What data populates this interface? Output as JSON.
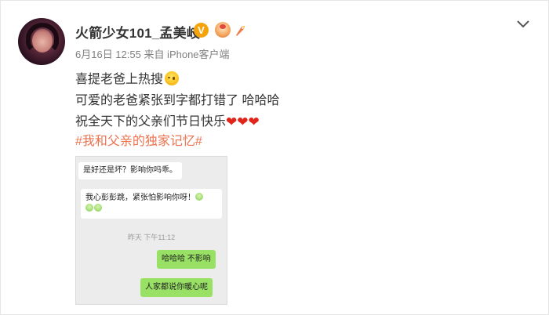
{
  "post": {
    "username": "火箭少女101_孟美岐",
    "verified_badge": "V",
    "meta": "6月16日 12:55 来自 iPhone客户端",
    "lines": [
      "喜提老爸上热搜",
      "可爱的老爸紧张到字都打错了 哈哈哈",
      "祝全天下的父亲们节日快乐"
    ],
    "hashtag": "#我和父亲的独家记忆#",
    "icons": {
      "line1_emoji": "embarrassed-face-icon",
      "hearts": [
        "heart-icon",
        "heart-icon",
        "heart-icon"
      ]
    }
  },
  "chat": {
    "msg1": "是好还是坏？影响你吗乖。",
    "msg2": "我心彭彭跳，紧张怕影响你呀！",
    "timestamp": "昨天 下午11:12",
    "msg3": "哈哈哈 不影响",
    "msg4": "人家都说你暖心呢"
  },
  "colors": {
    "hashtag": "#eb7350",
    "verified": "#f5a30a",
    "chat_sent": "#98e165",
    "heart": "#e1251b"
  }
}
